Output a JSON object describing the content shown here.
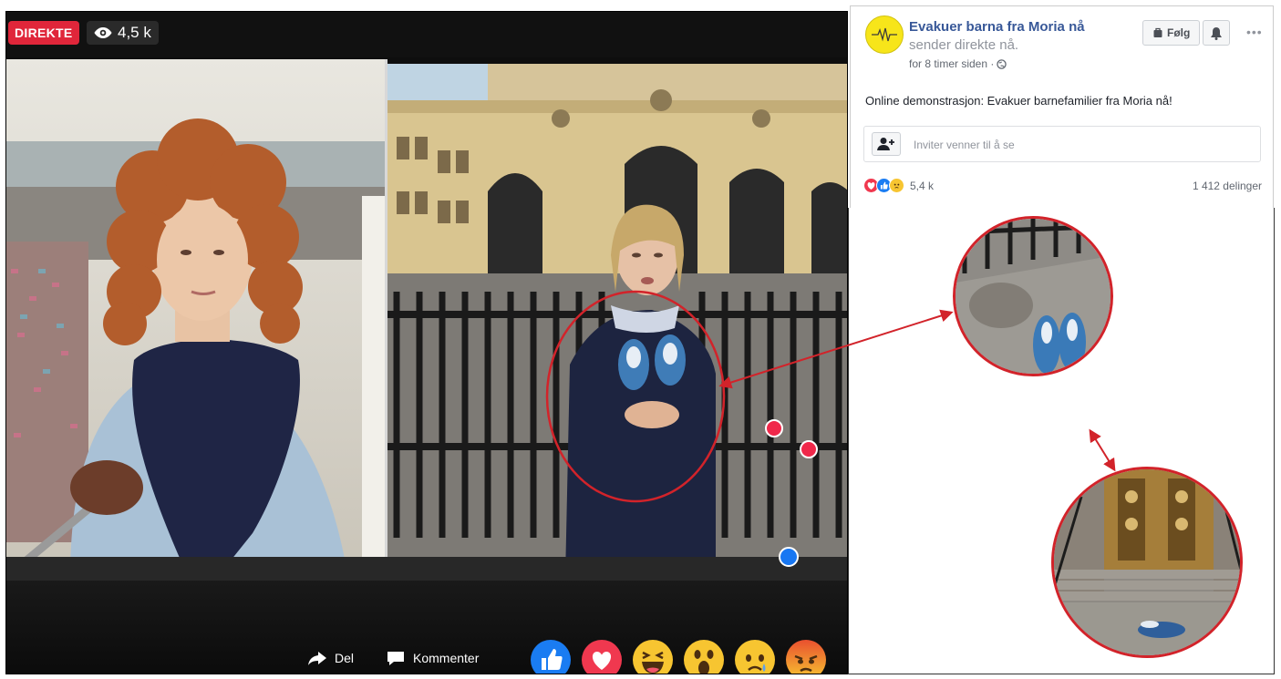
{
  "video": {
    "live_badge": "DIREKTE",
    "viewer_count": "4,5 k",
    "viewer_icon": "eye-icon",
    "actions": {
      "share_label": "Del",
      "comment_label": "Kommenter"
    },
    "reactions": [
      "like",
      "love",
      "haha",
      "wow",
      "sad",
      "angry"
    ]
  },
  "post": {
    "page_name": "Evakuer barna fra Moria nå",
    "live_status": "sender direkte nå.",
    "time_ago": "for 8 timer siden ·",
    "follow_label": "Følg",
    "text": "Online demonstrasjon: Evakuer barnefamilier fra Moria nå!",
    "invite_placeholder": "Inviter venner til å se",
    "reaction_count": "5,4 k",
    "share_count": "1 412 delinger"
  },
  "colors": {
    "live_red": "#e0263a",
    "link_blue": "#385898",
    "annotation_red": "#d2232a",
    "fb_blue": "#1877f2"
  }
}
